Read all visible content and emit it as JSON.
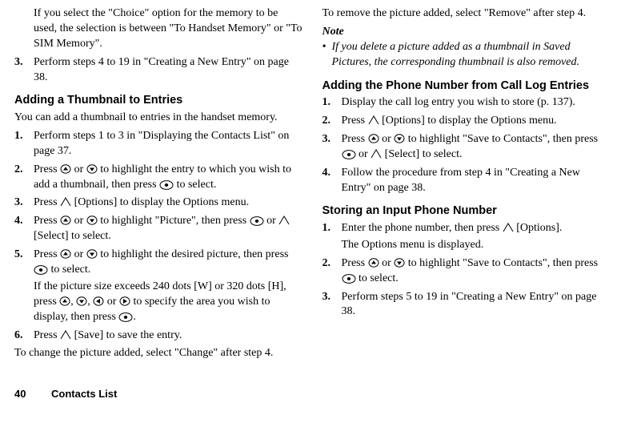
{
  "left": {
    "introLines": [
      "If you select the \"Choice\" option for the memory to be used, the selection is between \"To Handset Memory\" or \"To SIM Memory\"."
    ],
    "introStep": {
      "num": "3.",
      "textA": "Perform steps 4 to 19 in \"Creating a New Entry\" on page 38."
    },
    "h1": "Adding a Thumbnail to Entries",
    "h1sub": "You can add a thumbnail to entries in the handset memory.",
    "s1": {
      "num": "1.",
      "text": "Perform steps 1 to 3 in \"Displaying the Contacts List\" on page 37."
    },
    "s2": {
      "num": "2.",
      "a": "Press ",
      "b": " or ",
      "c": " to highlight the entry to which you wish to add a thumbnail, then press ",
      "d": " to select."
    },
    "s3": {
      "num": "3.",
      "a": "Press ",
      "b": " [Options] to display the Options menu."
    },
    "s4": {
      "num": "4.",
      "a": "Press ",
      "b": " or ",
      "c": " to highlight \"Picture\", then press ",
      "d": " or ",
      "e": " [Select] to select."
    },
    "s5": {
      "num": "5.",
      "a": "Press ",
      "b": " or ",
      "c": " to highlight the desired picture, then press ",
      "d": " to select.",
      "extraA": "If the picture size exceeds 240 dots [W] or 320 dots [H], press ",
      "extraB": ", ",
      "extraC": ", ",
      "extraD": " or ",
      "extraE": " to specify the area you wish to display, then press ",
      "extraF": "."
    },
    "s6": {
      "num": "6.",
      "a": "Press ",
      "b": " [Save] to save the entry."
    },
    "tail": "To change the picture added, select \"Change\" after step 4."
  },
  "right": {
    "top": "To remove the picture added, select \"Remove\" after step 4.",
    "noteLabel": "Note",
    "noteText": "If you delete a picture added as a thumbnail in Saved Pictures, the corresponding thumbnail is also removed.",
    "h2": "Adding the Phone Number from Call Log Entries",
    "r1": {
      "num": "1.",
      "text": "Display the call log entry you wish to store (p. 137)."
    },
    "r2": {
      "num": "2.",
      "a": "Press ",
      "b": " [Options] to display the Options menu."
    },
    "r3": {
      "num": "3.",
      "a": "Press ",
      "b": " or ",
      "c": " to highlight \"Save to Contacts\", then press ",
      "d": " or ",
      "e": " [Select] to select."
    },
    "r4": {
      "num": "4.",
      "text": "Follow the procedure from step 4 in \"Creating a New Entry\" on page 38."
    },
    "h3": "Storing an Input Phone Number",
    "p1": {
      "num": "1.",
      "a": "Enter the phone number, then press ",
      "b": " [Options].",
      "extra": "The Options menu is displayed."
    },
    "p2": {
      "num": "2.",
      "a": "Press ",
      "b": " or ",
      "c": " to highlight \"Save to Contacts\", then press ",
      "d": " to select."
    },
    "p3": {
      "num": "3.",
      "text": "Perform steps 5 to 19 in \"Creating a New Entry\" on page 38."
    }
  },
  "footer": {
    "page": "40",
    "section": "Contacts List"
  }
}
